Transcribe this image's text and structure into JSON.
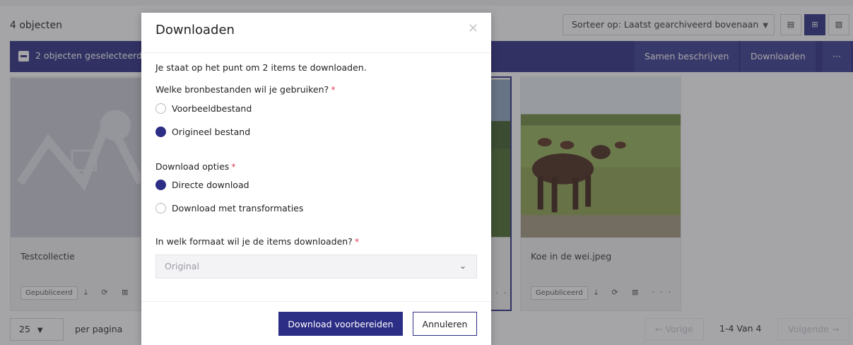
{
  "toolbar": {
    "count": "4 objecten",
    "sort_label": "Sorteer op: Laatst gearchiveerd bovenaan",
    "view_icons": [
      "list-view-icon",
      "grid-view-icon",
      "map-view-icon"
    ]
  },
  "selection_bar": {
    "text": "2 objecten geselecteerd",
    "actions": [
      "Samen beschrijven",
      "Downloaden",
      "···"
    ]
  },
  "cards": [
    {
      "name": "Testcollectie",
      "status": "Gepubliceerd",
      "icons": "⤓ ⟳ ⊠"
    },
    {
      "name": "",
      "status": "",
      "icons": "···"
    },
    {
      "name": "Koe in de wei.jpeg",
      "status": "Gepubliceerd",
      "icons": "⤓ ⟳ ⊠ ···"
    }
  ],
  "footer": {
    "per_page_value": "25",
    "per_page_label": "per pagina",
    "prev": "← Vorige",
    "range": "1-4 Van 4",
    "next": "Volgende →"
  },
  "modal": {
    "title": "Downloaden",
    "close": "✕",
    "intro": "Je staat op het punt om 2 items te downloaden.",
    "q_source": "Welke bronbestanden wil je gebruiken?",
    "source_options": [
      "Voorbeeldbestand",
      "Origineel bestand"
    ],
    "source_selected": 1,
    "q_options": "Download opties",
    "download_options": [
      "Directe download",
      "Download met transformaties"
    ],
    "download_selected": 0,
    "q_format": "In welk formaat wil je de items downloaden?",
    "format_placeholder": "Original",
    "required_mark": "*",
    "primary": "Download voorbereiden",
    "secondary": "Annuleren"
  },
  "colors": {
    "brand": "#2c2d85",
    "required": "#e0445a"
  }
}
